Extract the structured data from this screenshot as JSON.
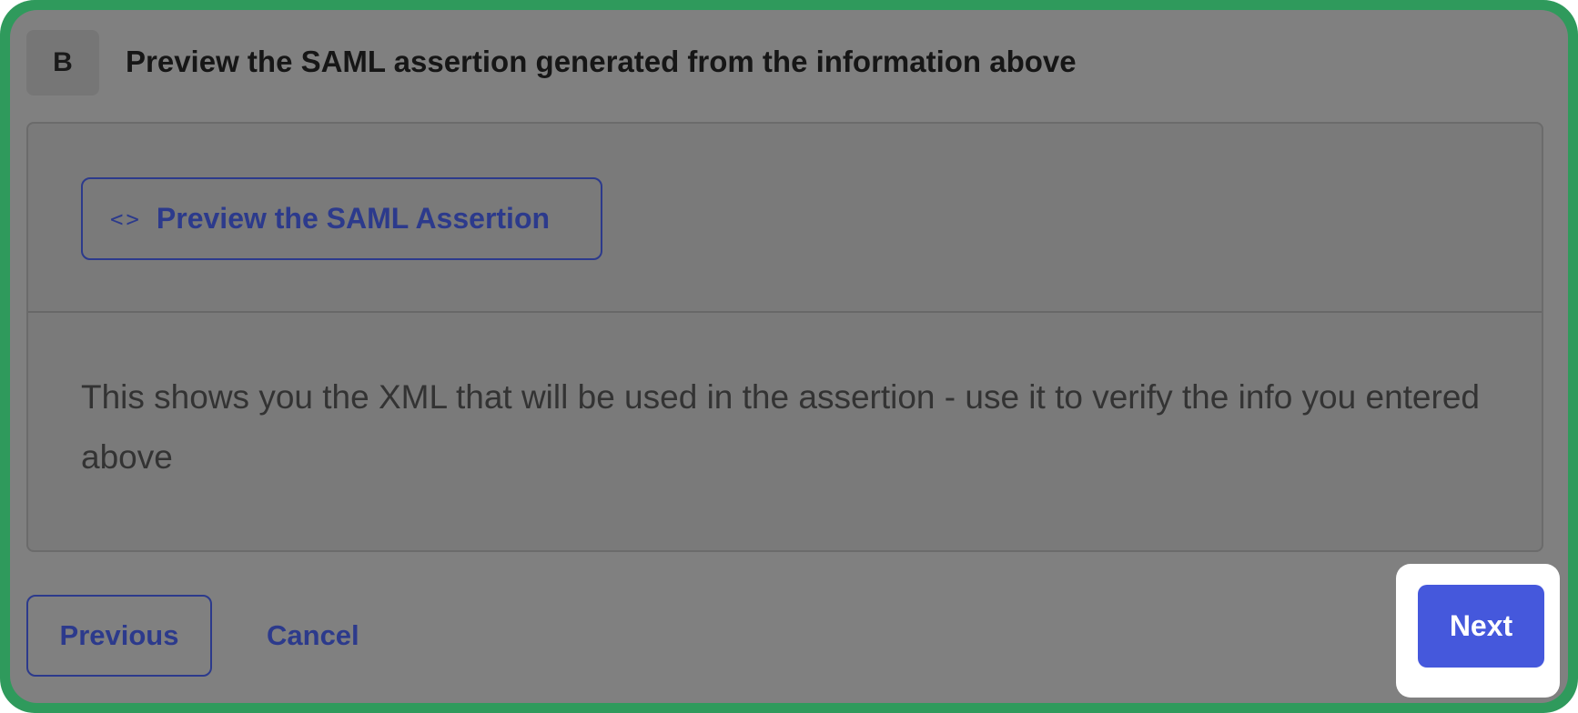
{
  "step": {
    "badge": "B",
    "title": "Preview the SAML assertion generated from the information above"
  },
  "card": {
    "preview_button_label": "Preview the SAML Assertion",
    "preview_button_icon": "code-icon",
    "description": "This shows you the XML that will be used in the assertion - use it to verify the info you entered above"
  },
  "footer": {
    "previous_label": "Previous",
    "cancel_label": "Cancel",
    "next_label": "Next"
  },
  "colors": {
    "frame_border": "#2f9a5c",
    "accent": "#2c3a8c",
    "primary_button": "#4558dc",
    "overlay": "#808080"
  }
}
